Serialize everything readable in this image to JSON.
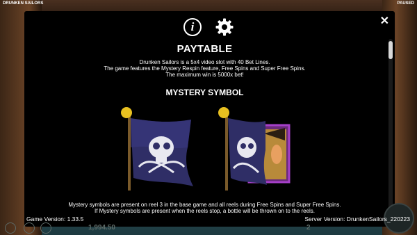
{
  "top_bar": {
    "game_name": "DRUNKEN SAILORS",
    "status": "PAUSED"
  },
  "dialog": {
    "title": "PAYTABLE",
    "description_lines": [
      "Drunken Sailors is a 5x4 video slot with 40 Bet Lines.",
      "The game features the Mystery Respin feature, Free Spins and Super Free Spins.",
      "The maximum win is 5000x bet!"
    ],
    "section_title": "MYSTERY SYMBOL",
    "footnote_lines": [
      "Mystery symbols are present on reel 3 in the base game and all reels during Free Spins and Super Free Spins.",
      "If Mystery symbols are present when the reels stop, a bottle will be thrown on to the reels."
    ],
    "close_label": "✕",
    "info_icon": "i",
    "icons": [
      "info-icon",
      "gear-icon",
      "close-icon"
    ]
  },
  "versions": {
    "game_version": "Game Version:  1.33.5",
    "server_version": "Server Version:  DrunkenSailors_220223"
  },
  "bottom_bar": {
    "balance": "1,994.50",
    "bet": "2"
  },
  "colors": {
    "dialog_bg": "#000000",
    "flag": "#2f2e66",
    "frame": "#a53fc8",
    "gold": "#e8c020"
  }
}
